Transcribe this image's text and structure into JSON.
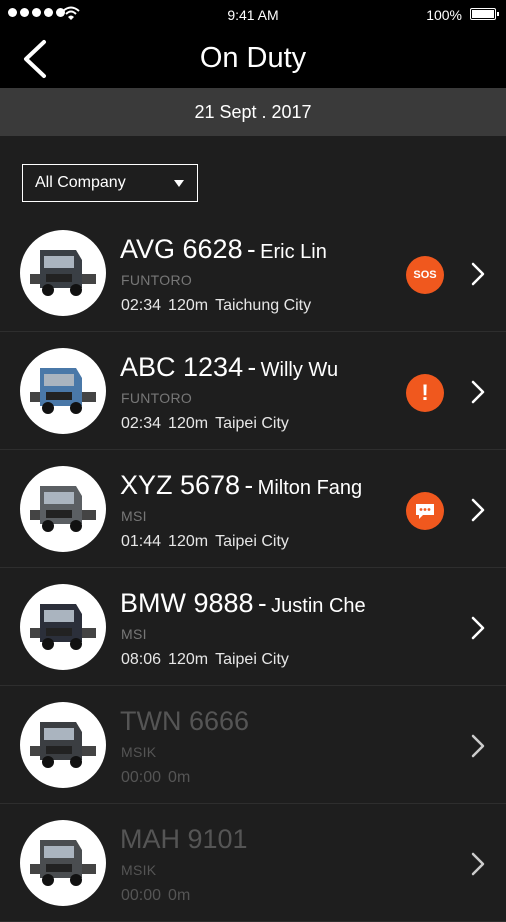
{
  "status_bar": {
    "time": "9:41 AM",
    "battery": "100%",
    "battery_level": 1.0,
    "icons": [
      "signal-dots-icon",
      "wifi-icon",
      "battery-icon"
    ]
  },
  "header": {
    "title": "On Duty",
    "back_icon": "chevron-left-icon"
  },
  "date_bar": {
    "date": "21 Sept . 2017"
  },
  "filter": {
    "selected": "All Company",
    "icon": "caret-down-icon"
  },
  "colors": {
    "background": "#1e1e1e",
    "header": "#000000",
    "date_bar": "#3a3a3a",
    "accent": "#f0581e",
    "inactive_text": "#555555"
  },
  "separator": "-",
  "vehicles": [
    {
      "plate": "AVG 6628",
      "driver": "Eric Lin",
      "company": "FUNTORO",
      "duration": "02:34",
      "distance": "120m",
      "location": "Taichung City",
      "alert": "SOS",
      "alert_icon": "sos-icon",
      "active": true
    },
    {
      "plate": "ABC 1234",
      "driver": "Willy Wu",
      "company": "FUNTORO",
      "duration": "02:34",
      "distance": "120m",
      "location": "Taipei City",
      "alert": "!",
      "alert_icon": "warning-icon",
      "active": true
    },
    {
      "plate": "XYZ 5678",
      "driver": "Milton Fang",
      "company": "MSI",
      "duration": "01:44",
      "distance": "120m",
      "location": "Taipei City",
      "alert": "",
      "alert_icon": "message-icon",
      "active": true
    },
    {
      "plate": "BMW 9888",
      "driver": "Justin Che",
      "company": "MSI",
      "duration": "08:06",
      "distance": "120m",
      "location": "Taipei City",
      "alert": "",
      "alert_icon": "",
      "active": true
    },
    {
      "plate": "TWN 6666",
      "driver": "",
      "company": "MSIK",
      "duration": "00:00",
      "distance": "0m",
      "location": "",
      "alert": "",
      "alert_icon": "",
      "active": false
    },
    {
      "plate": "MAH 9101",
      "driver": "",
      "company": "MSIK",
      "duration": "00:00",
      "distance": "0m",
      "location": "",
      "alert": "",
      "alert_icon": "",
      "active": false
    }
  ]
}
